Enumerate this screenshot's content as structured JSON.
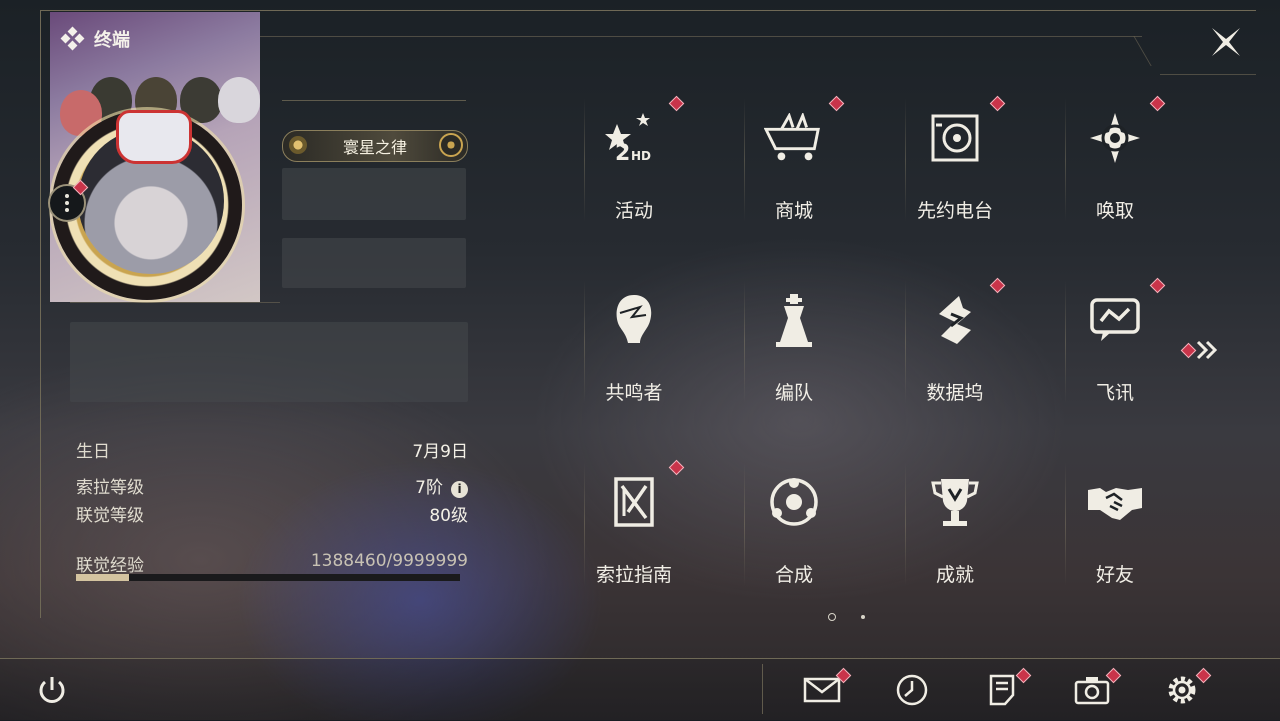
{
  "header": {
    "title": "终端"
  },
  "profile": {
    "title_badge": "寰星之律",
    "birthday_label": "生日",
    "birthday_value": "7月9日",
    "sola_level_label": "索拉等级",
    "sola_level_value": "7阶",
    "union_level_label": "联觉等级",
    "union_level_value": "80级",
    "exp_label": "联觉经验",
    "exp_value": "1388460/9999999",
    "exp_fraction": 0.139
  },
  "menu": {
    "items": [
      {
        "label": "活动",
        "icon": "event-2hd-icon",
        "badge": true
      },
      {
        "label": "商城",
        "icon": "shop-cart-icon",
        "badge": true
      },
      {
        "label": "先约电台",
        "icon": "radio-icon",
        "badge": true
      },
      {
        "label": "唤取",
        "icon": "convene-compass-icon",
        "badge": true
      },
      {
        "label": "共鸣者",
        "icon": "resonator-icon",
        "badge": false
      },
      {
        "label": "编队",
        "icon": "team-chess-icon",
        "badge": false
      },
      {
        "label": "数据坞",
        "icon": "data-bank-icon",
        "badge": true
      },
      {
        "label": "飞讯",
        "icon": "message-icon",
        "badge": true
      },
      {
        "label": "索拉指南",
        "icon": "guidebook-icon",
        "badge": true
      },
      {
        "label": "合成",
        "icon": "synthesis-icon",
        "badge": false
      },
      {
        "label": "成就",
        "icon": "trophy-icon",
        "badge": false
      },
      {
        "label": "好友",
        "icon": "handshake-icon",
        "badge": false
      }
    ]
  },
  "colors": {
    "accent": "#c9344a",
    "gold": "#c9a450",
    "line": "#6f6956"
  }
}
